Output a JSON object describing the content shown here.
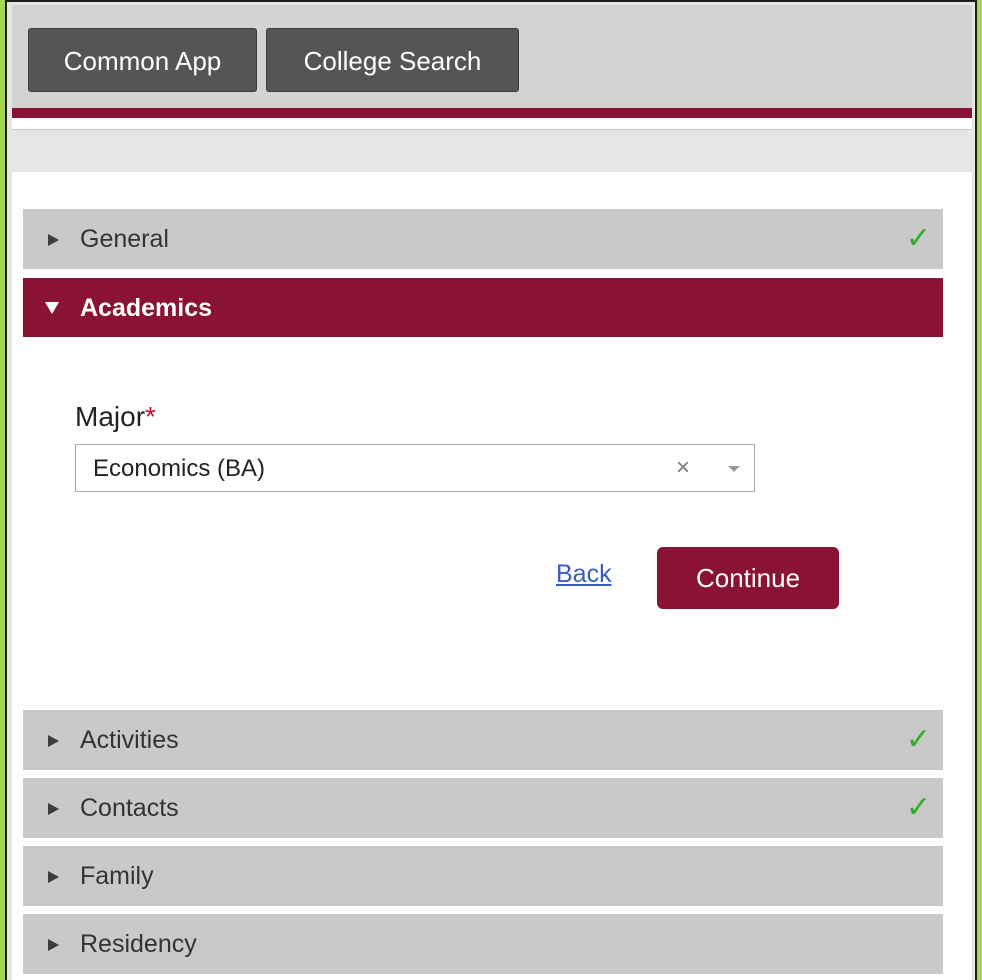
{
  "top_nav": {
    "common_app_label": "Common App",
    "college_search_label": "College Search"
  },
  "colors": {
    "brand": "#8a1234",
    "success": "#2fae2a",
    "link": "#3a5bbf"
  },
  "accordion": {
    "general": {
      "label": "General",
      "check": "✓"
    },
    "academics": {
      "label": "Academics"
    },
    "activities": {
      "label": "Activities",
      "check": "✓"
    },
    "contacts": {
      "label": "Contacts",
      "check": "✓"
    },
    "family": {
      "label": "Family"
    },
    "residency": {
      "label": "Residency"
    }
  },
  "academics_form": {
    "major_label": "Major",
    "required_marker": "*",
    "major_value": "Economics (BA)",
    "clear_symbol": "×"
  },
  "actions": {
    "back_label": "Back",
    "continue_label": "Continue"
  }
}
